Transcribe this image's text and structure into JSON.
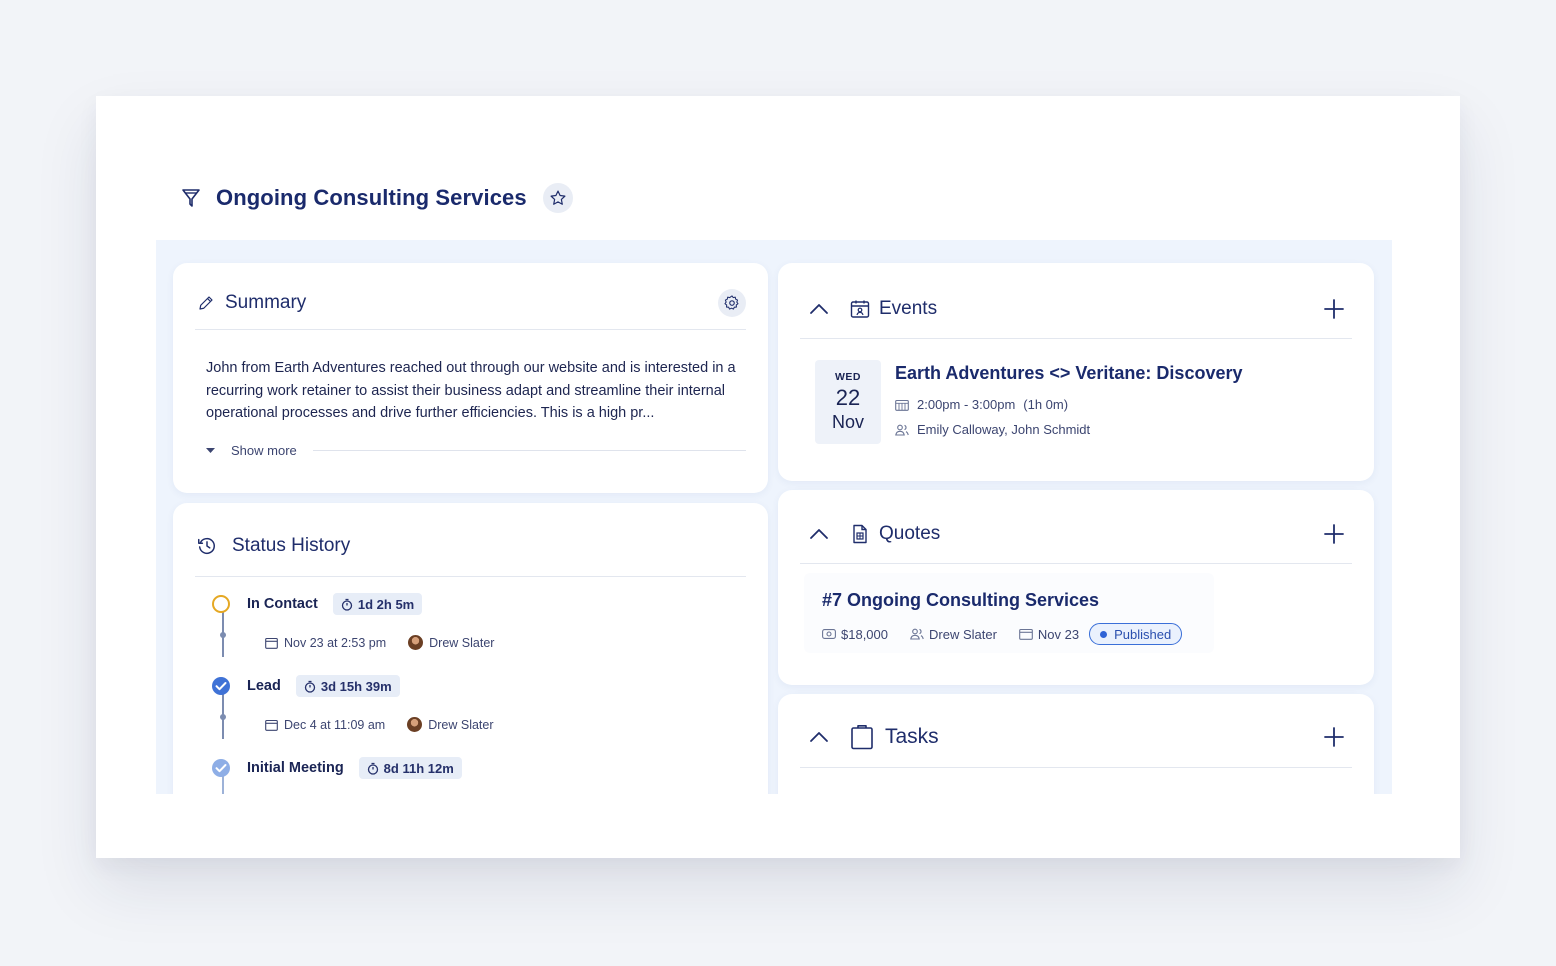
{
  "header": {
    "title": "Ongoing Consulting Services"
  },
  "summary": {
    "title": "Summary",
    "text": "John from Earth Adventures reached out through our website and is interested in a recurring work retainer to assist their business adapt and streamline their internal operational processes and drive further efficiencies. This is a high pr...",
    "show_more": "Show more"
  },
  "status_history": {
    "title": "Status History",
    "entries": [
      {
        "name": "In Contact",
        "duration": "1d 2h 5m",
        "date": "Nov 23 at 2:53 pm",
        "user": "Drew Slater",
        "state": "current"
      },
      {
        "name": "Lead",
        "duration": "3d 15h 39m",
        "date": "Dec 4 at 11:09 am",
        "user": "Drew Slater",
        "state": "done"
      },
      {
        "name": "Initial Meeting",
        "duration": "8d 11h 12m",
        "state": "done-light"
      }
    ]
  },
  "events": {
    "title": "Events",
    "items": [
      {
        "dow": "WED",
        "day": "22",
        "month": "Nov",
        "title": "Earth Adventures <> Veritane: Discovery",
        "time": "2:00pm - 3:00pm",
        "duration": "(1h 0m)",
        "attendees": "Emily Calloway,  John Schmidt"
      }
    ]
  },
  "quotes": {
    "title": "Quotes",
    "items": [
      {
        "title": "#7 Ongoing Consulting Services",
        "amount": "$18,000",
        "owner": "Drew Slater",
        "date": "Nov 23",
        "status": "Published"
      }
    ]
  },
  "tasks": {
    "title": "Tasks"
  },
  "colors": {
    "accent": "#2f63d6",
    "current_status": "#e5a823",
    "title": "#1a2a6c"
  }
}
